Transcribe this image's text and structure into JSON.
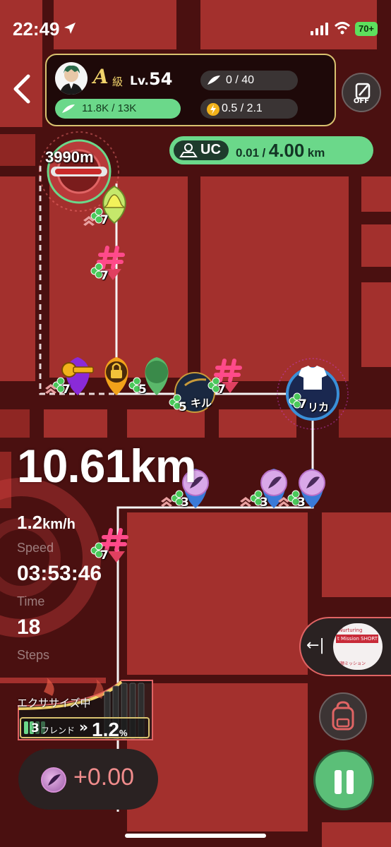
{
  "status_bar": {
    "time": "22:49",
    "battery": "70+"
  },
  "player": {
    "grade": "A",
    "grade_suffix": "級",
    "level_prefix": "Lv.",
    "level": "54"
  },
  "stamina": {
    "text": "11.8K / 13K"
  },
  "feather": {
    "text": "0 / 40"
  },
  "energy": {
    "text": "0.5 / 2.1"
  },
  "off_button": {
    "label": "OFF"
  },
  "uc": {
    "label": "UC",
    "current": "0.01",
    "separator": "/",
    "target": "4.00",
    "unit": "km"
  },
  "map": {
    "goal_distance": "3990m",
    "markers": [
      {
        "name": "marker-bell",
        "count": "7"
      },
      {
        "name": "marker-hashtag-1",
        "count": "7"
      },
      {
        "name": "marker-key",
        "count": "7"
      },
      {
        "name": "marker-lock",
        "count": "5"
      },
      {
        "name": "marker-kill",
        "count": "5",
        "label": "キル"
      },
      {
        "name": "marker-hashtag-2",
        "count": "7"
      },
      {
        "name": "marker-shirt",
        "count": "7",
        "label": "リカ"
      },
      {
        "name": "marker-feather-1",
        "count": "3"
      },
      {
        "name": "marker-feather-2",
        "count": "3"
      },
      {
        "name": "marker-feather-3",
        "count": "3"
      },
      {
        "name": "marker-hashtag-3",
        "count": "7"
      }
    ]
  },
  "stats": {
    "distance": "10.61km",
    "speed_value": "1.2",
    "speed_unit": "km/h",
    "speed_label": "Speed",
    "time_value": "03:53:46",
    "time_label": "Time",
    "steps_value": "18",
    "steps_label": "Steps"
  },
  "exercise": {
    "label": "エクササイズ中",
    "friend_count": "3",
    "friend_label": "フレンド",
    "arrows": "»",
    "bonus": "1.2",
    "bonus_unit": "%",
    "level_fill": 0.35
  },
  "coin": {
    "text": "+0.00"
  },
  "side_panel": {
    "line1": "Nurturing",
    "line2": "t Mission SHORT",
    "line3": "高額ミッション"
  },
  "colors": {
    "accent_green": "#6bd88a",
    "gold": "#d9c270",
    "map_red": "#a3302d",
    "road": "#4a1010"
  }
}
